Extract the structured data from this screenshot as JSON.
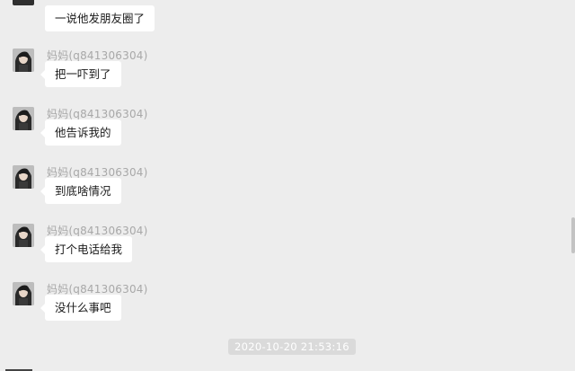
{
  "top_message": {
    "text": "一说他发朋友圈了"
  },
  "messages": [
    {
      "sender": "妈妈(q841306304)",
      "text": "把一吓到了"
    },
    {
      "sender": "妈妈(q841306304)",
      "text": "他告诉我的"
    },
    {
      "sender": "妈妈(q841306304)",
      "text": "到底啥情况"
    },
    {
      "sender": "妈妈(q841306304)",
      "text": "打个电话给我"
    },
    {
      "sender": "妈妈(q841306304)",
      "text": "没什么事吧"
    }
  ],
  "timestamp": "2020-10-20 21:53:16",
  "icons": {
    "avatar": "avatar-photo",
    "scrollbar": "scrollbar-thumb"
  },
  "colors": {
    "background": "#ededed",
    "bubble": "#ffffff",
    "sender": "#a8a8a8",
    "timestamp_bg": "#dadada"
  }
}
